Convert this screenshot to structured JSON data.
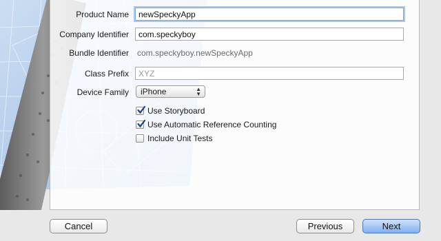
{
  "form": {
    "product_name": {
      "label": "Product Name",
      "value": "newSpeckyApp"
    },
    "company_identifier": {
      "label": "Company Identifier",
      "value": "com.speckyboy"
    },
    "bundle_identifier": {
      "label": "Bundle Identifier",
      "value": "com.speckyboy.newSpeckyApp"
    },
    "class_prefix": {
      "label": "Class Prefix",
      "value": "",
      "placeholder": "XYZ"
    },
    "device_family": {
      "label": "Device Family",
      "selected": "iPhone"
    },
    "checkboxes": [
      {
        "label": "Use Storyboard",
        "checked": true
      },
      {
        "label": "Use Automatic Reference Counting",
        "checked": true
      },
      {
        "label": "Include Unit Tests",
        "checked": false
      }
    ]
  },
  "buttons": {
    "cancel": "Cancel",
    "previous": "Previous",
    "next": "Next"
  },
  "colors": {
    "blueprint": "#a9c6ea",
    "primary_button": "#7fb0ef",
    "focus_ring": "#a9c8ef"
  }
}
